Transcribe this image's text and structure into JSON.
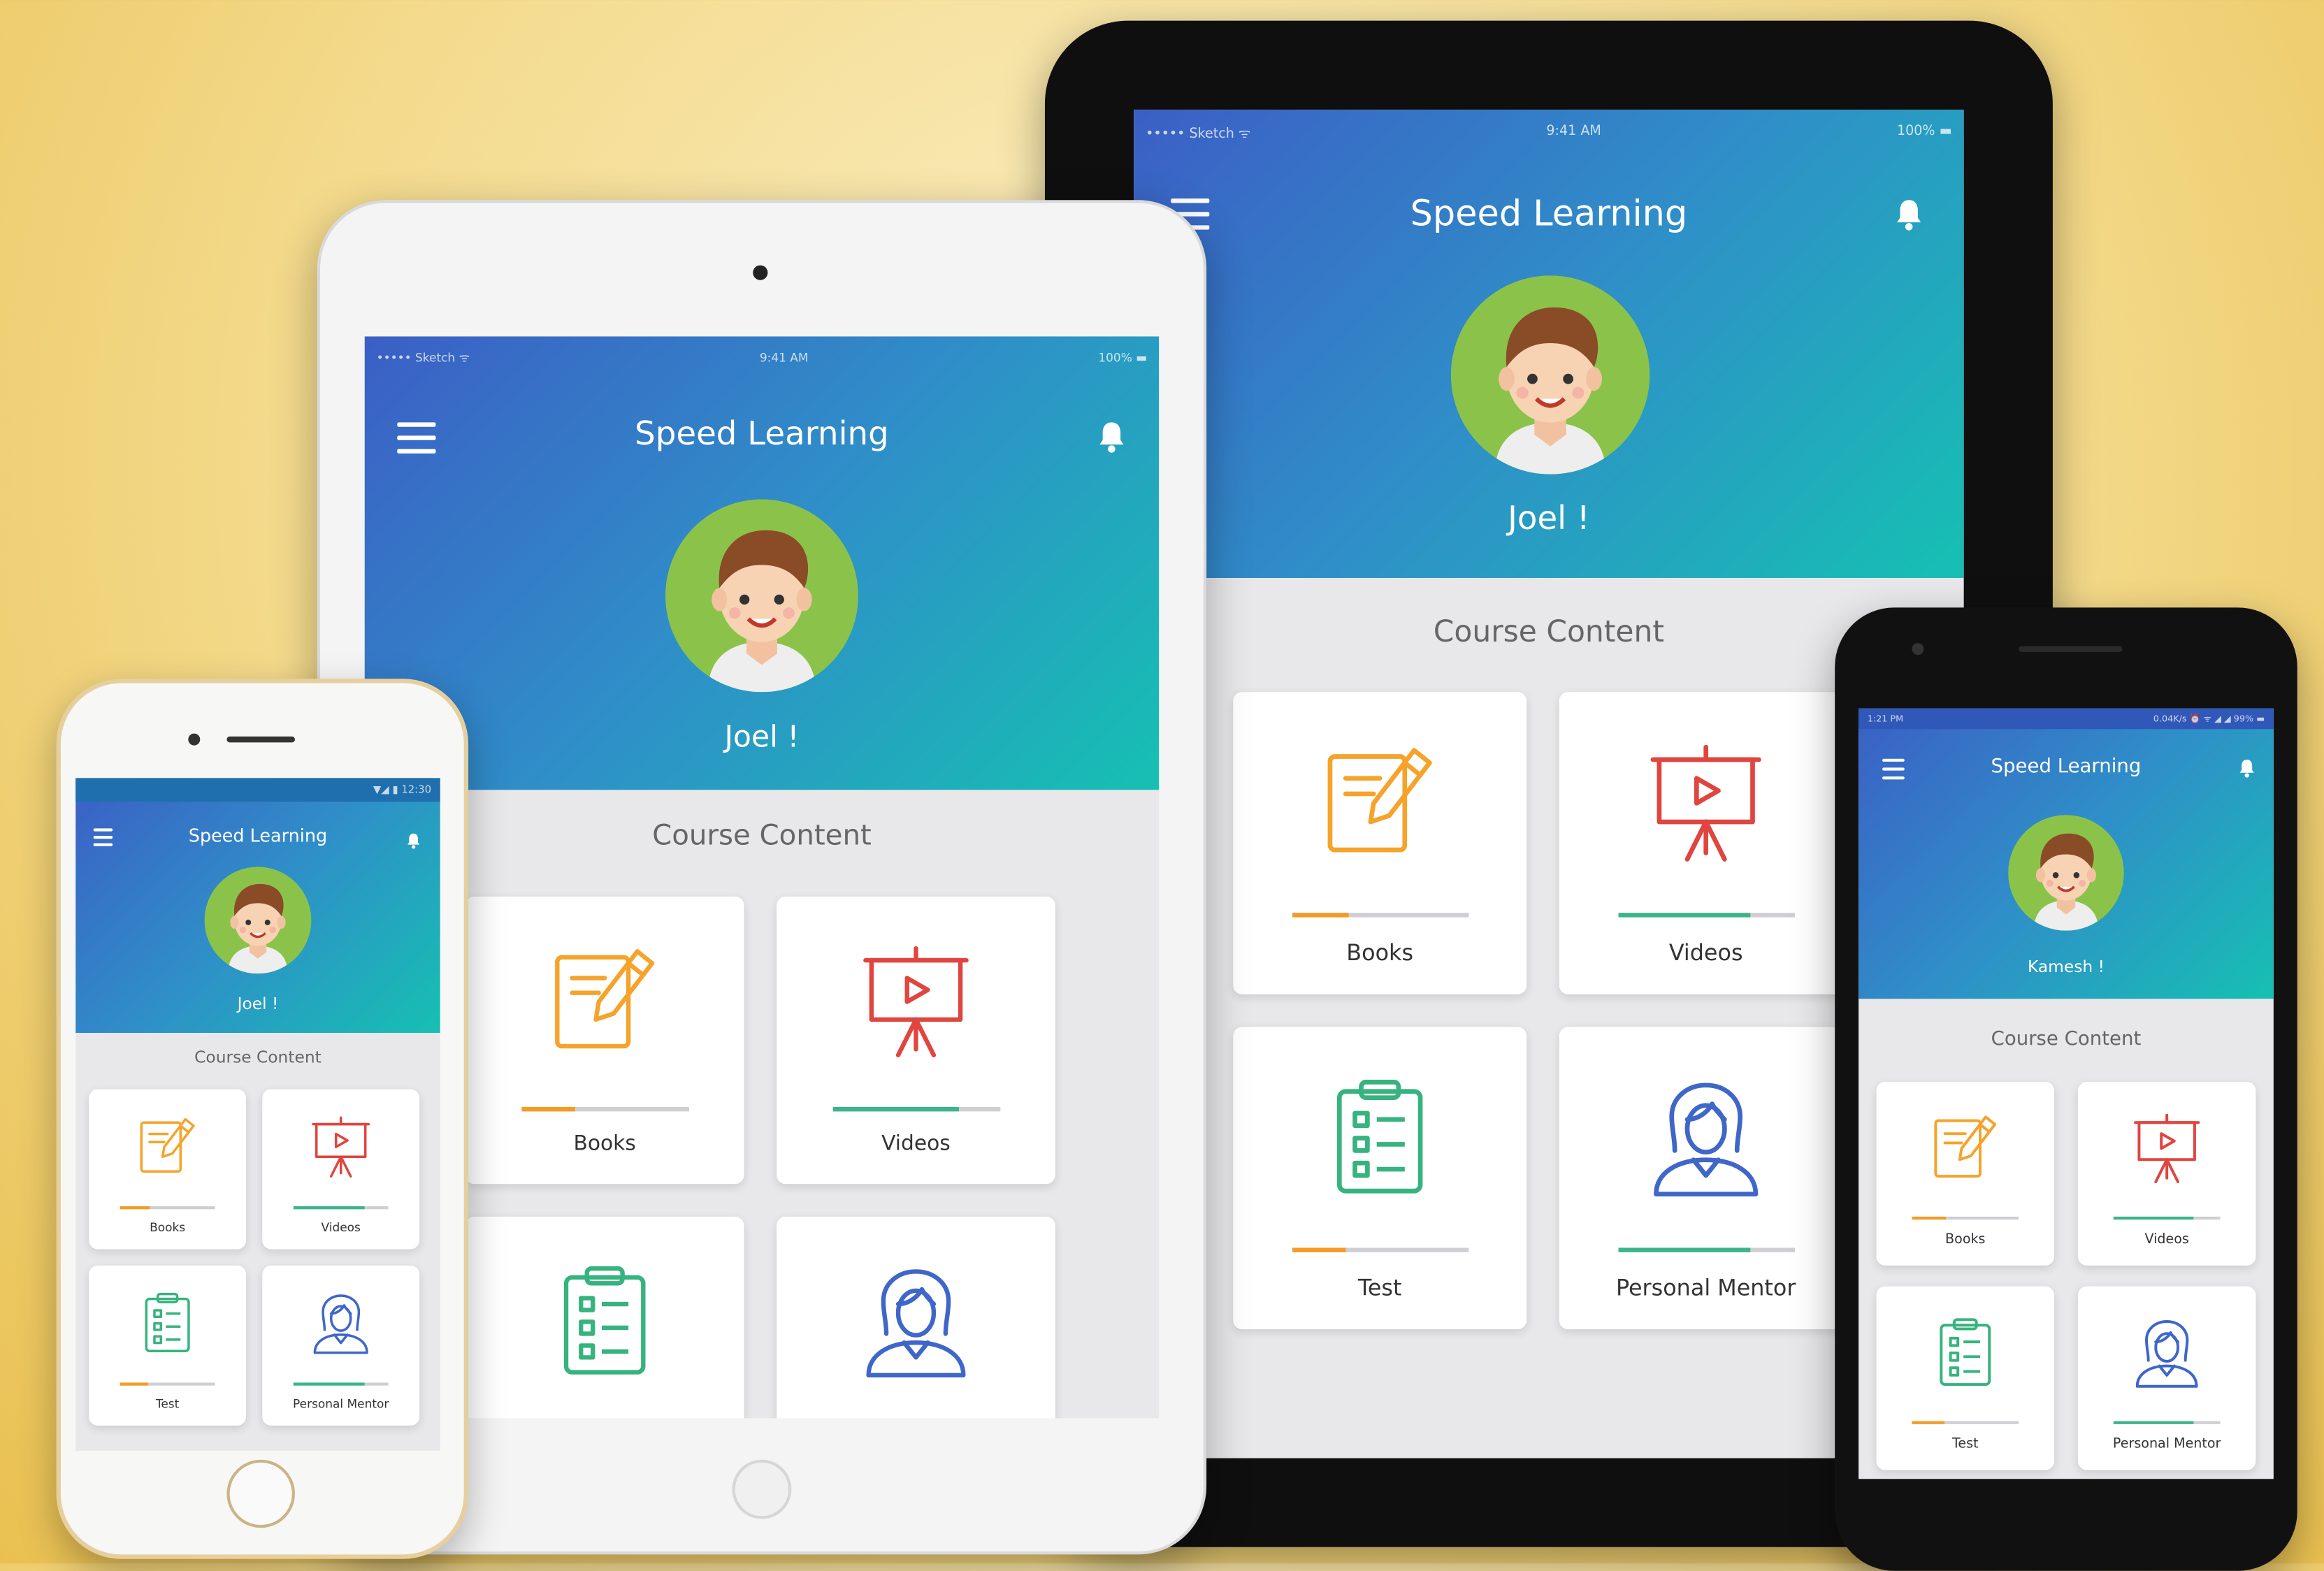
{
  "app": {
    "title": "Speed Learning",
    "section_title": "Course Content",
    "accent": "#2f8fc8",
    "gradient": [
      "#3b5fc5",
      "#16c0b2"
    ]
  },
  "courses": [
    {
      "label": "Books",
      "icon": "notebook-pencil-icon",
      "color": "#f5a32b",
      "progress": 0.32,
      "bar_color": "#f59b25"
    },
    {
      "label": "Videos",
      "icon": "presentation-board-icon",
      "color": "#e0453f",
      "progress": 0.75,
      "bar_color": "#3cb48a"
    },
    {
      "label": "Test",
      "icon": "clipboard-checklist-icon",
      "color": "#36b37e",
      "progress": 0.3,
      "bar_color": "#f59b25"
    },
    {
      "label": "Personal Mentor",
      "icon": "woman-mentor-icon",
      "color": "#3f66c9",
      "progress": 0.75,
      "bar_color": "#3cb48a"
    }
  ],
  "devices": {
    "ipad_black": {
      "status": {
        "carrier": "••••• Sketch ᯤ",
        "time": "9:41 AM",
        "battery": "100% ▬"
      },
      "user_name": "Joel !"
    },
    "ipad_white": {
      "status": {
        "carrier": "••••• Sketch ᯤ",
        "time": "9:41 AM",
        "battery": "100% ▬"
      },
      "user_name": "Joel !"
    },
    "iphone": {
      "status": {
        "right": "▼◢ ▮ 12:30"
      },
      "user_name": "Joel !"
    },
    "android": {
      "status": {
        "left": "1:21 PM",
        "right": "0.04K/s ⏰ ᯤ ◢ ◢ 99% ▬"
      },
      "user_name": "Kamesh !"
    }
  }
}
